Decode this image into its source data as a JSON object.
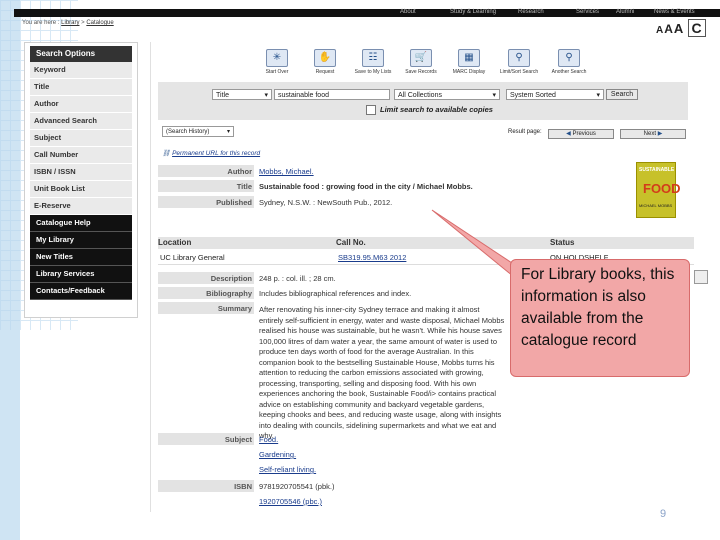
{
  "breadcrumb": {
    "prefix": "You are here :",
    "library": "Library",
    "catalogue": "Catalogue"
  },
  "font_size_controls": [
    "A",
    "A",
    "A",
    "C"
  ],
  "top_nav": [
    "About",
    "Study & Learning",
    "Research",
    "Services",
    "Alumni",
    "News & Events"
  ],
  "side_menu": {
    "header": "Search Options",
    "items": [
      "Keyword",
      "Title",
      "Author",
      "Advanced Search",
      "Subject",
      "Call Number",
      "ISBN / ISSN",
      "Unit Book List",
      "E-Reserve"
    ],
    "dark_items": [
      "Catalogue Help",
      "My Library",
      "New Titles",
      "Library Services",
      "Contacts/Feedback"
    ]
  },
  "toolbar": [
    "Start Over",
    "Request",
    "Save to My Lists",
    "Save Records",
    "MARC Display",
    "Limit/Sort Search",
    "Another Search"
  ],
  "search": {
    "field": "Title",
    "query": "sustainable food",
    "scope": "All Collections",
    "sort": "System Sorted",
    "search_button": "Search",
    "limit_label": "Limit search to available copies",
    "history": "(Search History)"
  },
  "result_nav": {
    "label": "Result page:",
    "previous": "Previous",
    "next": "Next"
  },
  "permanent_url": "Permanent URL for this record",
  "record": {
    "author_label": "Author",
    "author": "Mobbs, Michael.",
    "title_label": "Title",
    "title": "Sustainable food : growing food in the city / Michael Mobbs.",
    "published_label": "Published",
    "published": "Sydney, N.S.W. : NewSouth Pub., 2012.",
    "description_label": "Description",
    "description": "248 p. : col. ill. ; 28 cm.",
    "bibliography_label": "Bibliography",
    "bibliography": "Includes bibliographical references and index.",
    "summary_label": "Summary",
    "summary": "After renovating his inner-city Sydney terrace and making it almost entirely self-sufficient in energy, water and waste disposal, Michael Mobbs realised his house was sustainable, but he wasn't. While his house saves 100,000 litres of dam water a year, the same amount of water is used to produce ten days worth of food for the average Australian. In this companion book to the bestselling Sustainable House, Mobbs turns his attention to reducing the carbon emissions associated with growing, processing, transporting, selling and disposing food. With his own experiences anchoring the book, Sustainable Food/i> contains practical advice on establishing community and backyard vegetable gardens, keeping chooks and bees, and reducing waste usage, along with insights into dealing with councils, sidelining supermarkets and what we eat and why.",
    "subject_label": "Subject",
    "subjects": [
      "Food.",
      "Gardening.",
      "Self-reliant living."
    ],
    "isbn_label": "ISBN",
    "isbns": [
      "9781920705541 (pbk.)",
      "1920705546 (pbc.)"
    ]
  },
  "cover": {
    "title": "SUSTAINABLE",
    "word": "FOOD",
    "author": "MICHAEL MOBBS"
  },
  "holdings": {
    "headers": [
      "Location",
      "Call No.",
      "Status"
    ],
    "rows": [
      {
        "location": "UC Library General",
        "call_no": "SB319.95.M63 2012",
        "status": "ON HOLDSHELF"
      }
    ]
  },
  "callout": "For Library books, this information is also available from the catalogue record",
  "page_number": "9"
}
